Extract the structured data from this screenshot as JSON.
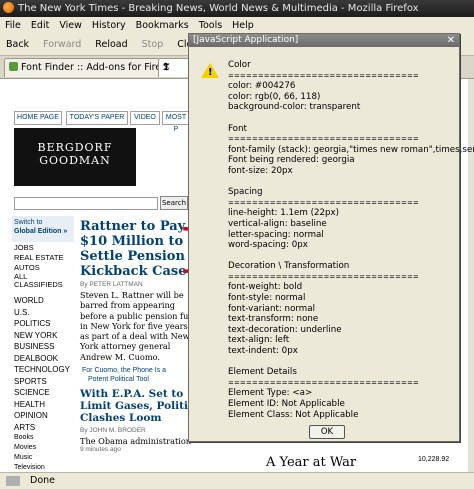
{
  "window": {
    "title": "The New York Times - Breaking News, World News & Multimedia - Mozilla Firefox"
  },
  "menu": [
    "File",
    "Edit",
    "View",
    "History",
    "Bookmarks",
    "Tools",
    "Help"
  ],
  "nav": {
    "back": "Back",
    "forward": "Forward",
    "reload": "Reload",
    "stop": "Stop",
    "clear": "Clear"
  },
  "tabs": {
    "tab1": "Font Finder :: Add-ons for Firefox"
  },
  "page": {
    "top_tabs": [
      "HOME PAGE",
      "TODAY'S PAPER",
      "VIDEO",
      "MOST P"
    ],
    "ad_line1": "BERGDORF",
    "ad_line2": "GOODMAN",
    "search_button": "Search",
    "switch_text1": "Switch to",
    "switch_text2": "Global Edition »",
    "left_links1": [
      "JOBS",
      "REAL ESTATE",
      "AUTOS",
      "ALL CLASSIFIEDS"
    ],
    "left_links2": [
      "WORLD",
      "U.S.",
      "POLITICS",
      "NEW YORK",
      "BUSINESS",
      "DEALBOOK",
      "TECHNOLOGY",
      "SPORTS",
      "SCIENCE",
      "HEALTH",
      "OPINION",
      "ARTS",
      "Books",
      "Movies",
      "Music",
      "Television"
    ],
    "headline1": [
      "Rattner to Pay",
      "$10 Million to",
      "Settle Pension",
      "Kickback Case"
    ],
    "byline1": "By PETER LATTMAN",
    "body1": [
      "Steven L. Rattner will be",
      "barred from appearing",
      "before a public pension fund",
      "in New York for five years",
      "as part of a deal with New",
      "York attorney general",
      "Andrew M. Cuomo."
    ],
    "related1": [
      "For Cuomo, the Phone Is a",
      "Potent Political Tool"
    ],
    "headline2": [
      "With E.P.A. Set to",
      "Limit Gases, Political",
      "Clashes Loom"
    ],
    "byline2": "By JOHN M. BRODER",
    "body2": "The Obama administration",
    "ticker_minutes": "9 minutes ago",
    "bottom_banner": "A Year at War",
    "right_number": "10,228.92"
  },
  "status": {
    "text": "Done"
  },
  "dialog": {
    "title": "[JavaScript Application]",
    "lines": [
      "Color",
      "================================",
      "color: #004276",
      "color: rgb(0, 66, 118)",
      "background-color: transparent",
      "",
      "Font",
      "================================",
      "font-family (stack): georgia,\"times new roman\",times,serif",
      "Font being rendered: georgia",
      "font-size: 20px",
      "",
      "Spacing",
      "================================",
      "line-height: 1.1em (22px)",
      "vertical-align: baseline",
      "letter-spacing: normal",
      "word-spacing: 0px",
      "",
      "Decoration \\ Transformation",
      "================================",
      "font-weight: bold",
      "font-style: normal",
      "font-variant: normal",
      "text-transform: none",
      "text-decoration: underline",
      "text-align: left",
      "text-indent: 0px",
      "",
      "Element Details",
      "================================",
      "Element Type: <a>",
      "Element ID: Not Applicable",
      "Element Class: Not Applicable"
    ],
    "ok": "OK"
  },
  "colors": {
    "nyt_link": "#004276",
    "bracket": "#d0021b"
  }
}
